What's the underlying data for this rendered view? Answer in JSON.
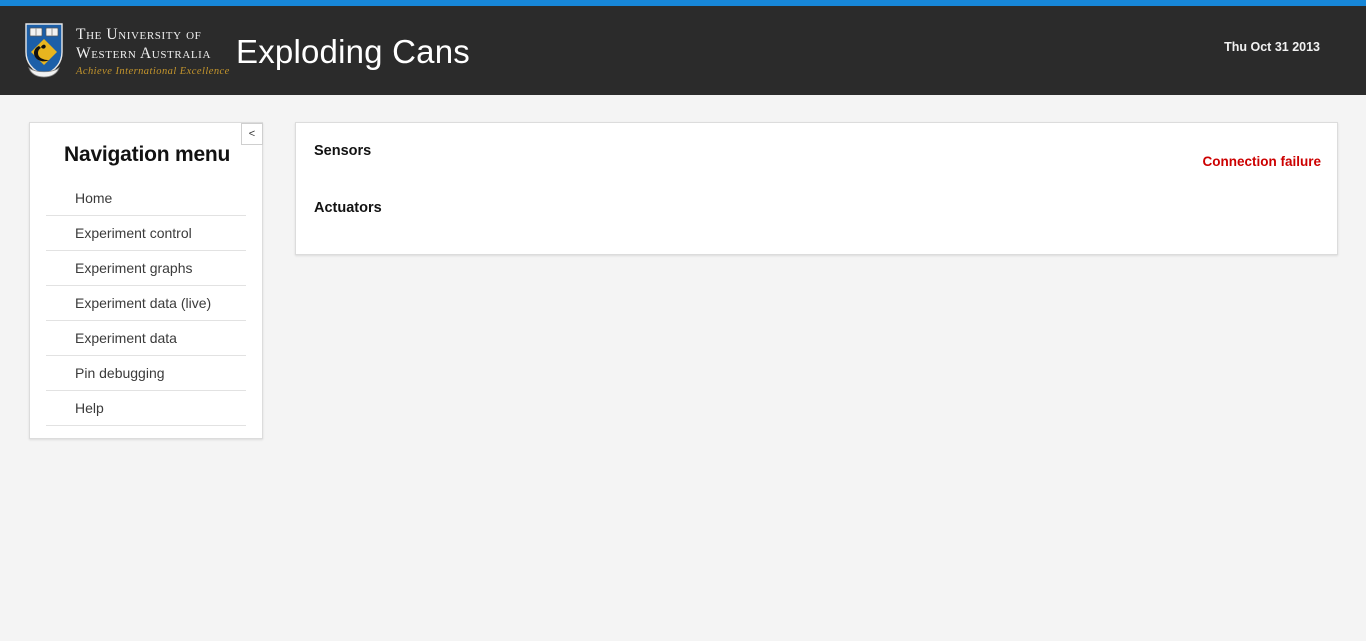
{
  "theme": {
    "accent_blue": "#1787d8",
    "header_bg": "#2b2b2b",
    "page_bg": "#f4f4f4",
    "panel_bg": "#ffffff",
    "error_red": "#cc0000",
    "logo_gold": "#c4952c"
  },
  "header": {
    "logo": {
      "icon": "uwa-crest-icon",
      "line1": "The University of",
      "line2": "Western Australia",
      "tagline": "Achieve International Excellence"
    },
    "app_title": "Exploding Cans",
    "date": "Thu Oct 31 2013"
  },
  "sidebar": {
    "title": "Navigation menu",
    "collapse_label": "<",
    "items": [
      {
        "label": "Home"
      },
      {
        "label": "Experiment control"
      },
      {
        "label": "Experiment graphs"
      },
      {
        "label": "Experiment data (live)"
      },
      {
        "label": "Experiment data"
      },
      {
        "label": "Pin debugging"
      },
      {
        "label": "Help"
      }
    ]
  },
  "main": {
    "sensors_heading": "Sensors",
    "actuators_heading": "Actuators",
    "connection_status": "Connection failure"
  }
}
